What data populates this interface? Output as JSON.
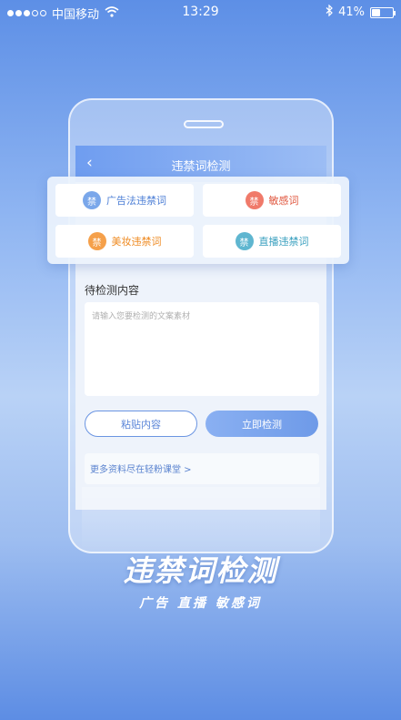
{
  "status_bar": {
    "carrier": "中国移动",
    "time": "13:29",
    "battery": "41%",
    "battery_level": 0.41,
    "icons": [
      "signal-dots-icon",
      "wifi-icon",
      "bluetooth-icon",
      "battery-icon"
    ]
  },
  "app": {
    "title": "违禁词检测",
    "back_icon": "‹"
  },
  "categories": [
    {
      "label": "广告法违禁词",
      "icon_text": "禁",
      "color": "#7aa7ea",
      "text_color": "#4d7fd6"
    },
    {
      "label": "敏感词",
      "icon_text": "禁",
      "color": "#f07a6a",
      "text_color": "#e0573f"
    },
    {
      "label": "美妆违禁词",
      "icon_text": "禁",
      "color": "#f5a04a",
      "text_color": "#ef8b23"
    },
    {
      "label": "直播违禁词",
      "icon_text": "禁",
      "color": "#5fb6d0",
      "text_color": "#3aa0bf"
    }
  ],
  "content": {
    "label": "待检测内容",
    "placeholder": "请输入您要检测的文案素材",
    "value": ""
  },
  "buttons": {
    "paste": "粘贴内容",
    "check": "立即检测"
  },
  "more_link": "更多资料尽在轻粉课堂 >",
  "promo": {
    "headline": "违禁词检测",
    "subheadline": "广告  直播  敏感词"
  },
  "colors": {
    "accent": "#6e9ae8",
    "background_top": "#5d8fe6"
  }
}
